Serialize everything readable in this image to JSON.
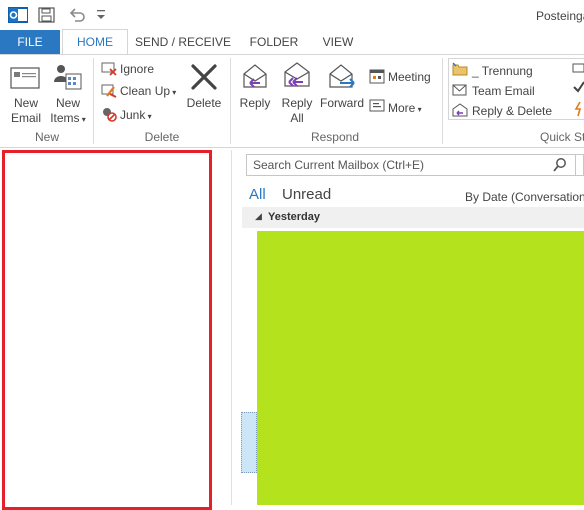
{
  "window": {
    "title": "Posteinga"
  },
  "tabs": [
    "FILE",
    "HOME",
    "SEND / RECEIVE",
    "FOLDER",
    "VIEW"
  ],
  "ribbon": {
    "new_group": {
      "label": "New",
      "new_email": "New\nEmail",
      "new_items": "New\nItems"
    },
    "delete_group": {
      "label": "Delete",
      "ignore": "Ignore",
      "clean_up": "Clean Up",
      "junk": "Junk",
      "delete": "Delete"
    },
    "respond_group": {
      "label": "Respond",
      "reply": "Reply",
      "reply_all": "Reply\nAll",
      "forward": "Forward",
      "meeting": "Meeting",
      "more": "More"
    },
    "quick_steps_group": {
      "label": "Quick St",
      "items": [
        "_ Trennung",
        "Team Email",
        "Reply & Delete"
      ]
    }
  },
  "mail": {
    "search_placeholder": "Search Current Mailbox (Ctrl+E)",
    "filter_all": "All",
    "filter_unread": "Unread",
    "sort": "By Date (Conversations)",
    "group_header": "Yesterday"
  },
  "colors": {
    "accent": "#2b78c2",
    "folder_border": "#e4202a",
    "content_block": "#b4e31e"
  }
}
